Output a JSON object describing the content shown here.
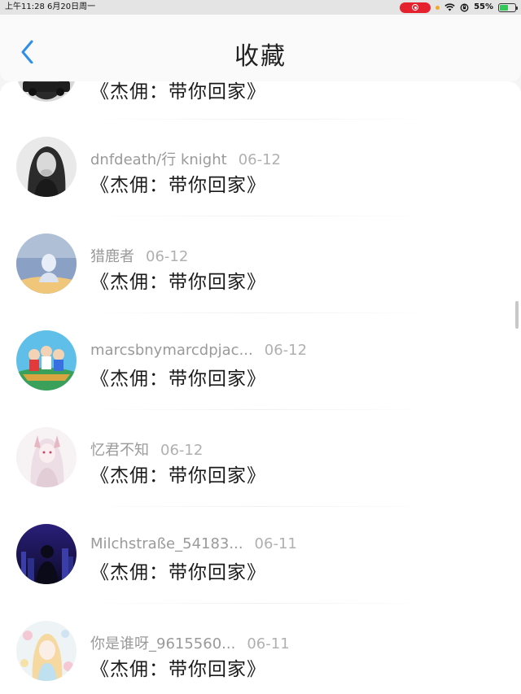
{
  "status_bar": {
    "time_date": "上午11:28   6月20日周一",
    "battery": "55%",
    "battery_level": 0.55,
    "colors": {
      "record": "#e5212d",
      "battery": "#34c759",
      "indicator": "#f5a623"
    }
  },
  "header": {
    "back_icon": "chevron-left-icon",
    "title": "收藏",
    "accent": "#2f8fe8"
  },
  "list": {
    "partial_item_content": "《杰佣：带你回家》",
    "items": [
      {
        "user": "dnfdeath/行 knight",
        "date": "06-12",
        "content": "《杰佣：带你回家》"
      },
      {
        "user": "猎鹿者",
        "date": "06-12",
        "content": "《杰佣：带你回家》"
      },
      {
        "user": "marcsbnymarcdpjac...",
        "date": "06-12",
        "content": "《杰佣：带你回家》"
      },
      {
        "user": "忆君不知",
        "date": "06-12",
        "content": "《杰佣：带你回家》"
      },
      {
        "user": "Milchstraße_54183...",
        "date": "06-11",
        "content": "《杰佣：带你回家》"
      },
      {
        "user": "你是谁呀_9615560...",
        "date": "06-11",
        "content": "《杰佣：带你回家》"
      }
    ]
  }
}
